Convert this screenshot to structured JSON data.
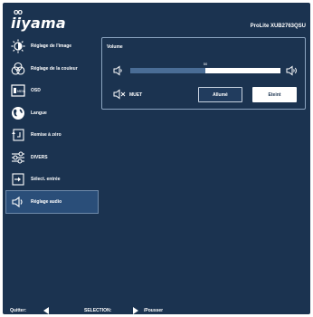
{
  "header": {
    "logo": "iiyama",
    "model": "ProLite XUB2763QSU"
  },
  "menu": {
    "items": [
      {
        "label": "Réglage de l'image",
        "icon": "brightness-icon"
      },
      {
        "label": "Réglage de la couleur",
        "icon": "color-circles-icon"
      },
      {
        "label": "OSD",
        "icon": "osd-icon"
      },
      {
        "label": "Langue",
        "icon": "globe-icon"
      },
      {
        "label": "Remise à zéro",
        "icon": "reset-icon"
      },
      {
        "label": "DIVERS",
        "icon": "sliders-icon"
      },
      {
        "label": "Sélect. entrée",
        "icon": "input-icon"
      },
      {
        "label": "Réglage audio",
        "icon": "speaker-icon"
      }
    ],
    "active_index": 7
  },
  "audio": {
    "volume_label": "Volume",
    "volume_value": "50",
    "volume_fraction": 0.5,
    "mute_label": "MUET",
    "on_label": "Allumé",
    "off_label": "Eteint",
    "selected": "Eteint"
  },
  "footer": {
    "quit_label": "Quitter:",
    "selection_label": "SELECTION:",
    "push_label": "/Pousser"
  },
  "colors": {
    "background": "#1b3350",
    "active_item": "#2a4e79",
    "slider_fill": "#4a6d96",
    "text": "#ffffff"
  }
}
